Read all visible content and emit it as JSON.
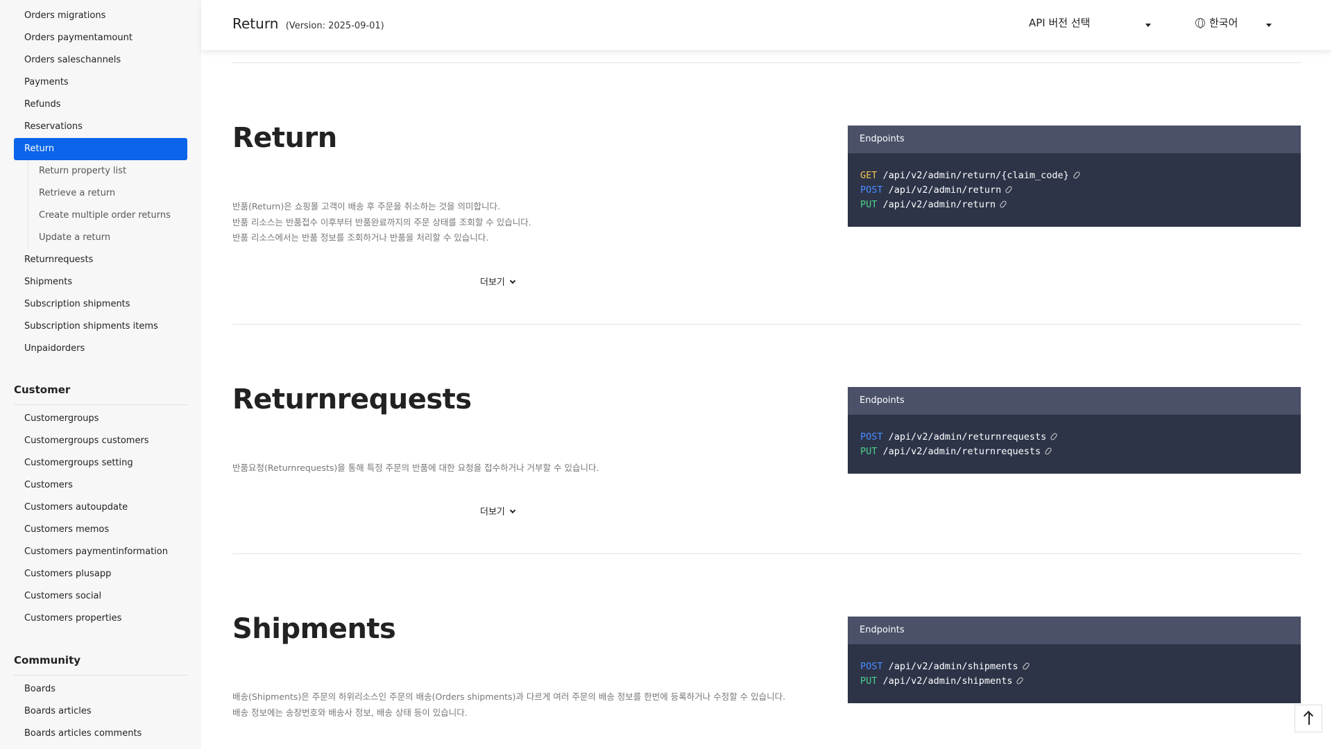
{
  "sidebar": {
    "items": [
      {
        "label": "Orders migrations"
      },
      {
        "label": "Orders paymentamount"
      },
      {
        "label": "Orders saleschannels"
      },
      {
        "label": "Payments"
      },
      {
        "label": "Refunds"
      },
      {
        "label": "Reservations"
      },
      {
        "label": "Return",
        "active": true
      }
    ],
    "return_subitems": [
      {
        "label": "Return property list"
      },
      {
        "label": "Retrieve a return"
      },
      {
        "label": "Create multiple order returns"
      },
      {
        "label": "Update a return"
      }
    ],
    "items_after": [
      {
        "label": "Returnrequests"
      },
      {
        "label": "Shipments"
      },
      {
        "label": "Subscription shipments"
      },
      {
        "label": "Subscription shipments items"
      },
      {
        "label": "Unpaidorders"
      }
    ],
    "customer_section": {
      "title": "Customer",
      "items": [
        {
          "label": "Customergroups"
        },
        {
          "label": "Customergroups customers"
        },
        {
          "label": "Customergroups setting"
        },
        {
          "label": "Customers"
        },
        {
          "label": "Customers autoupdate"
        },
        {
          "label": "Customers memos"
        },
        {
          "label": "Customers paymentinformation"
        },
        {
          "label": "Customers plusapp"
        },
        {
          "label": "Customers social"
        },
        {
          "label": "Customers properties"
        }
      ]
    },
    "community_section": {
      "title": "Community",
      "items": [
        {
          "label": "Boards"
        },
        {
          "label": "Boards articles"
        },
        {
          "label": "Boards articles comments"
        }
      ]
    }
  },
  "header": {
    "title": "Return",
    "version": "(Version: 2025-09-01)",
    "api_select_label": "API 버전 선택",
    "language_label": "한국어"
  },
  "sections": {
    "return": {
      "title": "Return",
      "desc": [
        "반품(Return)은 쇼핑몰 고객이 배송 후 주문을 취소하는 것을 의미합니다.",
        "반품 리소스는 반품접수 이후부터 반품완료까지의 주문 상태를 조회할 수 있습니다.",
        "반품 리소스에서는 반품 정보를 조회하거나 반품을 처리할 수 있습니다."
      ],
      "more_label": "더보기",
      "endpoints_header": "Endpoints",
      "endpoints": [
        {
          "method": "GET",
          "path": "/api/v2/admin/return/{claim_code}"
        },
        {
          "method": "POST",
          "path": "/api/v2/admin/return"
        },
        {
          "method": "PUT",
          "path": "/api/v2/admin/return"
        }
      ]
    },
    "returnrequests": {
      "title": "Returnrequests",
      "desc": [
        "반품요청(Returnrequests)을 통해 특정 주문의 반품에 대한 요청을 접수하거나 거부할 수 있습니다."
      ],
      "more_label": "더보기",
      "endpoints_header": "Endpoints",
      "endpoints": [
        {
          "method": "POST",
          "path": "/api/v2/admin/returnrequests"
        },
        {
          "method": "PUT",
          "path": "/api/v2/admin/returnrequests"
        }
      ]
    },
    "shipments": {
      "title": "Shipments",
      "desc": [
        "배송(Shipments)은 주문의 하위리소스인 주문의 배송(Orders shipments)과 다르게 여러 주문의 배송 정보를 한번에 등록하거나 수정할 수 있습니다.",
        "배송 정보에는 송장번호와 배송사 정보, 배송 상태 등이 있습니다."
      ],
      "endpoints_header": "Endpoints",
      "endpoints": [
        {
          "method": "POST",
          "path": "/api/v2/admin/shipments"
        },
        {
          "method": "PUT",
          "path": "/api/v2/admin/shipments"
        }
      ]
    }
  },
  "colors": {
    "accent": "#0b64ea",
    "get": "#f5c451",
    "post": "#4a8cff",
    "put": "#4cd08a",
    "endpoint_bg": "#2d3448"
  },
  "icons": {
    "scroll_top": "arrow-up-icon",
    "language": "globe-icon",
    "endpoint_link": "link-icon"
  }
}
